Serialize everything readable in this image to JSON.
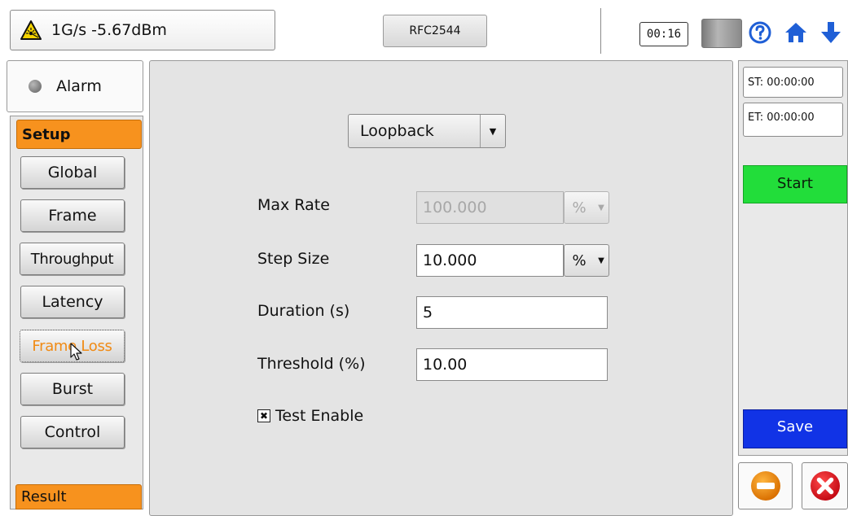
{
  "header": {
    "status_text": "1G/s -5.67dBm",
    "test_name": "RFC2544",
    "clock": "00:16",
    "icons": [
      "laser-warning-icon",
      "battery-icon",
      "help-icon",
      "home-icon",
      "down-arrow-icon"
    ]
  },
  "sidebar": {
    "alarm_label": "Alarm",
    "setup_header": "Setup",
    "items": [
      {
        "label": "Global"
      },
      {
        "label": "Frame"
      },
      {
        "label": "Throughput"
      },
      {
        "label": "Latency"
      },
      {
        "label": "Frame Loss"
      },
      {
        "label": "Burst"
      },
      {
        "label": "Control"
      }
    ],
    "result_header": "Result"
  },
  "form": {
    "mode_value": "Loopback",
    "max_rate_label": "Max Rate",
    "max_rate_value": "100.000",
    "max_rate_unit": "%",
    "step_size_label": "Step Size",
    "step_size_value": "10.000",
    "step_size_unit": "%",
    "duration_label": "Duration (s)",
    "duration_value": "5",
    "threshold_label": "Threshold (%)",
    "threshold_value": "10.00",
    "test_enable_label": "Test Enable",
    "test_enable_checked": true
  },
  "right": {
    "st_label": "ST:",
    "st_value": "00:00:00",
    "et_label": "ET:",
    "et_value": "00:00:00",
    "start_label": "Start",
    "save_label": "Save"
  },
  "colors": {
    "accent_orange": "#f7921e",
    "start_green": "#22dd3a",
    "save_blue": "#1133e6",
    "exit_red": "#e8202a"
  }
}
